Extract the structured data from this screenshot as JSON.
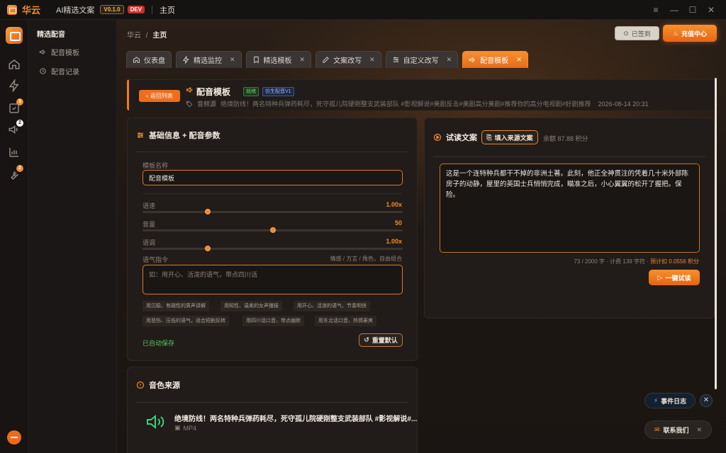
{
  "titlebar": {
    "brand": "华云",
    "app_name": "AI精选文案",
    "version": "V0.1.0",
    "env": "DEV",
    "page": "主页"
  },
  "rail": {
    "badges": {
      "docs": "3",
      "voice": "2",
      "tools": "2"
    }
  },
  "subnav": {
    "title": "精选配音",
    "items": [
      {
        "label": "配音模板",
        "icon": "megaphone-icon"
      },
      {
        "label": "配音记录",
        "icon": "history-icon"
      }
    ]
  },
  "header": {
    "breadcrumb_root": "华云",
    "breadcrumb_sep": "/",
    "breadcrumb_current": "主页",
    "signed_label": "已签到",
    "recharge_label": "充值中心"
  },
  "tabs": [
    {
      "label": "仪表盘",
      "icon": "home-icon"
    },
    {
      "label": "精选监控",
      "icon": "bolt-icon"
    },
    {
      "label": "精选模板",
      "icon": "bookmark-icon"
    },
    {
      "label": "文案改写",
      "icon": "edit-icon"
    },
    {
      "label": "自定义改写",
      "icon": "sliders-icon"
    },
    {
      "label": "配音模板",
      "icon": "megaphone-icon",
      "active": true
    }
  ],
  "template": {
    "back_label": "返回列表",
    "title": "配音模板",
    "status": "就绪",
    "model": "仿生配音V1",
    "source_label": "音频源",
    "source_desc": "绝境防线！两名特种兵弹药耗尽，死守孤儿院硬刚整支武装部队 #影视解说#美剧反击#美剧高分美剧#推荐你的高分电视剧#好剧推荐",
    "timestamp": "2026-08-14 20:31"
  },
  "basic": {
    "title": "基础信息 + 配音参数",
    "name_label": "模板名称",
    "name_value": "配音模板",
    "speed_label": "语速",
    "speed_value": "1.00x",
    "speed_level": 0.25,
    "volume_label": "音量",
    "volume_value": "50",
    "volume_level": 0.5,
    "pitch_label": "语调",
    "pitch_value": "1.00x",
    "pitch_level": 0.25,
    "tone_label": "语气指令",
    "tone_hint": "情感 / 方言 / 角色，自由组合",
    "tone_placeholder": "如：用开心、活泼的语气，带点四川话",
    "chips": [
      "用沉稳、有磁性的男声讲解",
      "用知性、温柔的女声播报",
      "用开心、活泼的语气，节奏明快",
      "用悲伤、压低的语气，适合短剧反转",
      "用四川话口音，带点幽默",
      "用东北话口音，热情豪爽"
    ],
    "autosave": "已自动保存",
    "reset_label": "重置默认"
  },
  "trial": {
    "title": "试读文案",
    "fill_label": "填入来源文案",
    "balance": "余额 87.88 积分",
    "text": "这是一个连特种兵都干不掉的非洲土著。此刻，他正全神贯注的凭着几十米外部陈房子的动静，屋里的英国士兵悄悄完成，瞄准之后，小心翼翼的松开了握把。保险。",
    "counter": "73 / 2000 字 · 计费 139 字符 ·",
    "cost": "预计扣 0.0556 积分",
    "play_label": "一键试读"
  },
  "source": {
    "title": "音色来源",
    "item_title": "绝境防线！两名特种兵弹药耗尽，死守孤儿院硬刚整支武装部队 #影视解说#...",
    "format": "MP4"
  },
  "floating": {
    "event_log": "事件日志",
    "contact": "联系我们"
  }
}
